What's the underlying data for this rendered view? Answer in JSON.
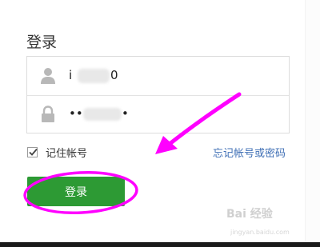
{
  "form": {
    "title": "登录",
    "username_value": "i",
    "username_suffix": "0",
    "password_value": "••",
    "password_suffix": "•",
    "remember_label": "记住帐号",
    "remember_checked": true,
    "forgot_link": "忘记帐号或密码",
    "login_label": "登录"
  },
  "icons": {
    "username": "user-icon",
    "password": "lock-icon",
    "checkbox": "checkmark-icon"
  },
  "colors": {
    "login_button": "#2d9a34",
    "link": "#3f6fb5",
    "annotation": "#ff00ff"
  },
  "watermark": {
    "logo": "Bai 经验",
    "url": "jingyan.baidu.com"
  }
}
